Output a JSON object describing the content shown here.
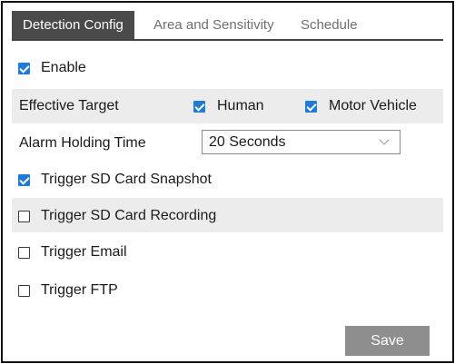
{
  "tabs": {
    "detection_config": "Detection Config",
    "area_sensitivity": "Area and Sensitivity",
    "schedule": "Schedule",
    "active": "Detection Config"
  },
  "enable": {
    "label": "Enable",
    "checked": true
  },
  "effective_target": {
    "label": "Effective Target",
    "human": {
      "label": "Human",
      "checked": true
    },
    "motor_vehicle": {
      "label": "Motor Vehicle",
      "checked": true
    }
  },
  "alarm_holding_time": {
    "label": "Alarm Holding Time",
    "selected": "20 Seconds"
  },
  "triggers": {
    "sd_snapshot": {
      "label": "Trigger SD Card Snapshot",
      "checked": true
    },
    "sd_recording": {
      "label": "Trigger SD Card Recording",
      "checked": false
    },
    "email": {
      "label": "Trigger Email",
      "checked": false
    },
    "ftp": {
      "label": "Trigger FTP",
      "checked": false
    }
  },
  "save_label": "Save",
  "colors": {
    "accent": "#1f7bd6",
    "tab_active": "#4a4a4a",
    "button": "#8e8e8e"
  }
}
